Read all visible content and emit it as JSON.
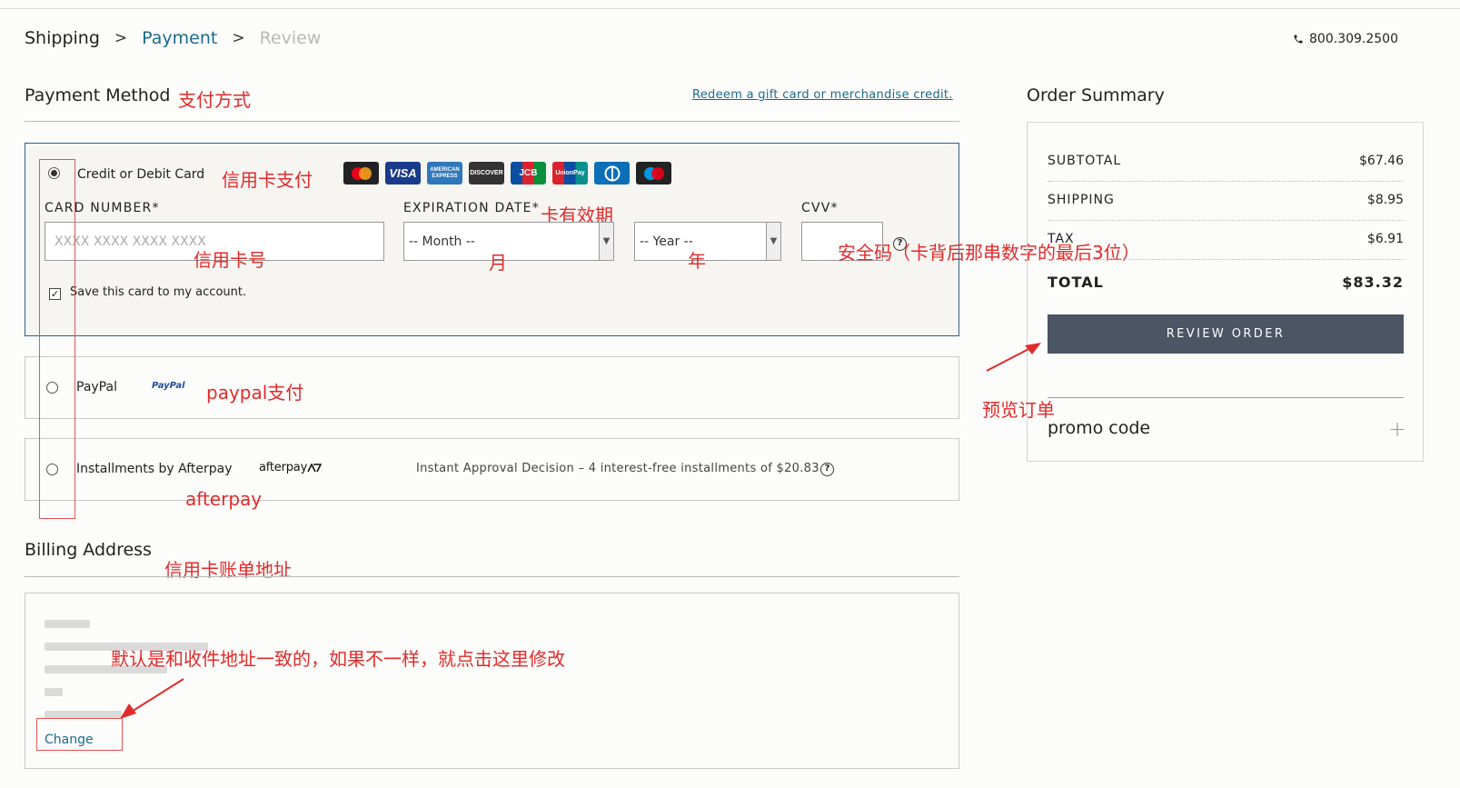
{
  "breadcrumb": {
    "shipping": "Shipping",
    "sep1": ">",
    "payment": "Payment",
    "sep2": ">",
    "review": "Review"
  },
  "phone": "800.309.2500",
  "payment": {
    "title": "Payment Method",
    "redeem_link": "Redeem a gift card or merchandise credit.",
    "credit_card": {
      "label": "Credit or Debit Card",
      "selected": true,
      "card_number_label": "CARD NUMBER*",
      "card_number_placeholder": "XXXX XXXX XXXX XXXX",
      "expiration_label": "EXPIRATION DATE*",
      "month_value": "-- Month --",
      "year_value": "-- Year --",
      "cvv_label": "CVV*",
      "save_card_label": "Save this card to my account.",
      "save_card_checked": true,
      "brands": [
        {
          "name": "mastercard",
          "text": "mastercard"
        },
        {
          "name": "visa",
          "text": "VISA"
        },
        {
          "name": "american-express",
          "text": "AMERICAN EXPRESS"
        },
        {
          "name": "discover",
          "text": "DISCOVER"
        },
        {
          "name": "jcb",
          "text": "JCB"
        },
        {
          "name": "unionpay",
          "text": "UnionPay"
        },
        {
          "name": "diners-club",
          "text": ""
        },
        {
          "name": "maestro",
          "text": "maestro"
        }
      ]
    },
    "paypal": {
      "label": "PayPal",
      "logo": "PayPal"
    },
    "afterpay": {
      "label": "Installments by Afterpay",
      "logo": "afterpay",
      "info": "Instant Approval Decision – 4 interest-free installments of $20.83"
    }
  },
  "billing": {
    "title": "Billing Address",
    "change_link": "Change"
  },
  "order_summary": {
    "title": "Order Summary",
    "rows": [
      {
        "label": "SUBTOTAL",
        "value": "$67.46"
      },
      {
        "label": "SHIPPING",
        "value": "$8.95"
      },
      {
        "label": "TAX",
        "value": "$6.91"
      }
    ],
    "total_label": "TOTAL",
    "total_value": "$83.32",
    "review_button": "REVIEW ORDER",
    "promo_label": "promo code",
    "promo_toggle": "+"
  },
  "annotations": {
    "payment_method": "支付方式",
    "credit_card": "信用卡支付",
    "expiration": "卡有效期",
    "card_number": "信用卡号",
    "month": "月",
    "year": "年",
    "cvv": "安全码（卡背后那串数字的最后3位）",
    "paypal": "paypal支付",
    "afterpay": "afterpay",
    "billing": "信用卡账单地址",
    "billing_change": "默认是和收件地址一致的，如果不一样，就点击这里修改",
    "review_order": "预览订单"
  },
  "colors": {
    "accent": "#1c6a89",
    "button": "#4b5563",
    "annotation": "#e02b2b"
  }
}
